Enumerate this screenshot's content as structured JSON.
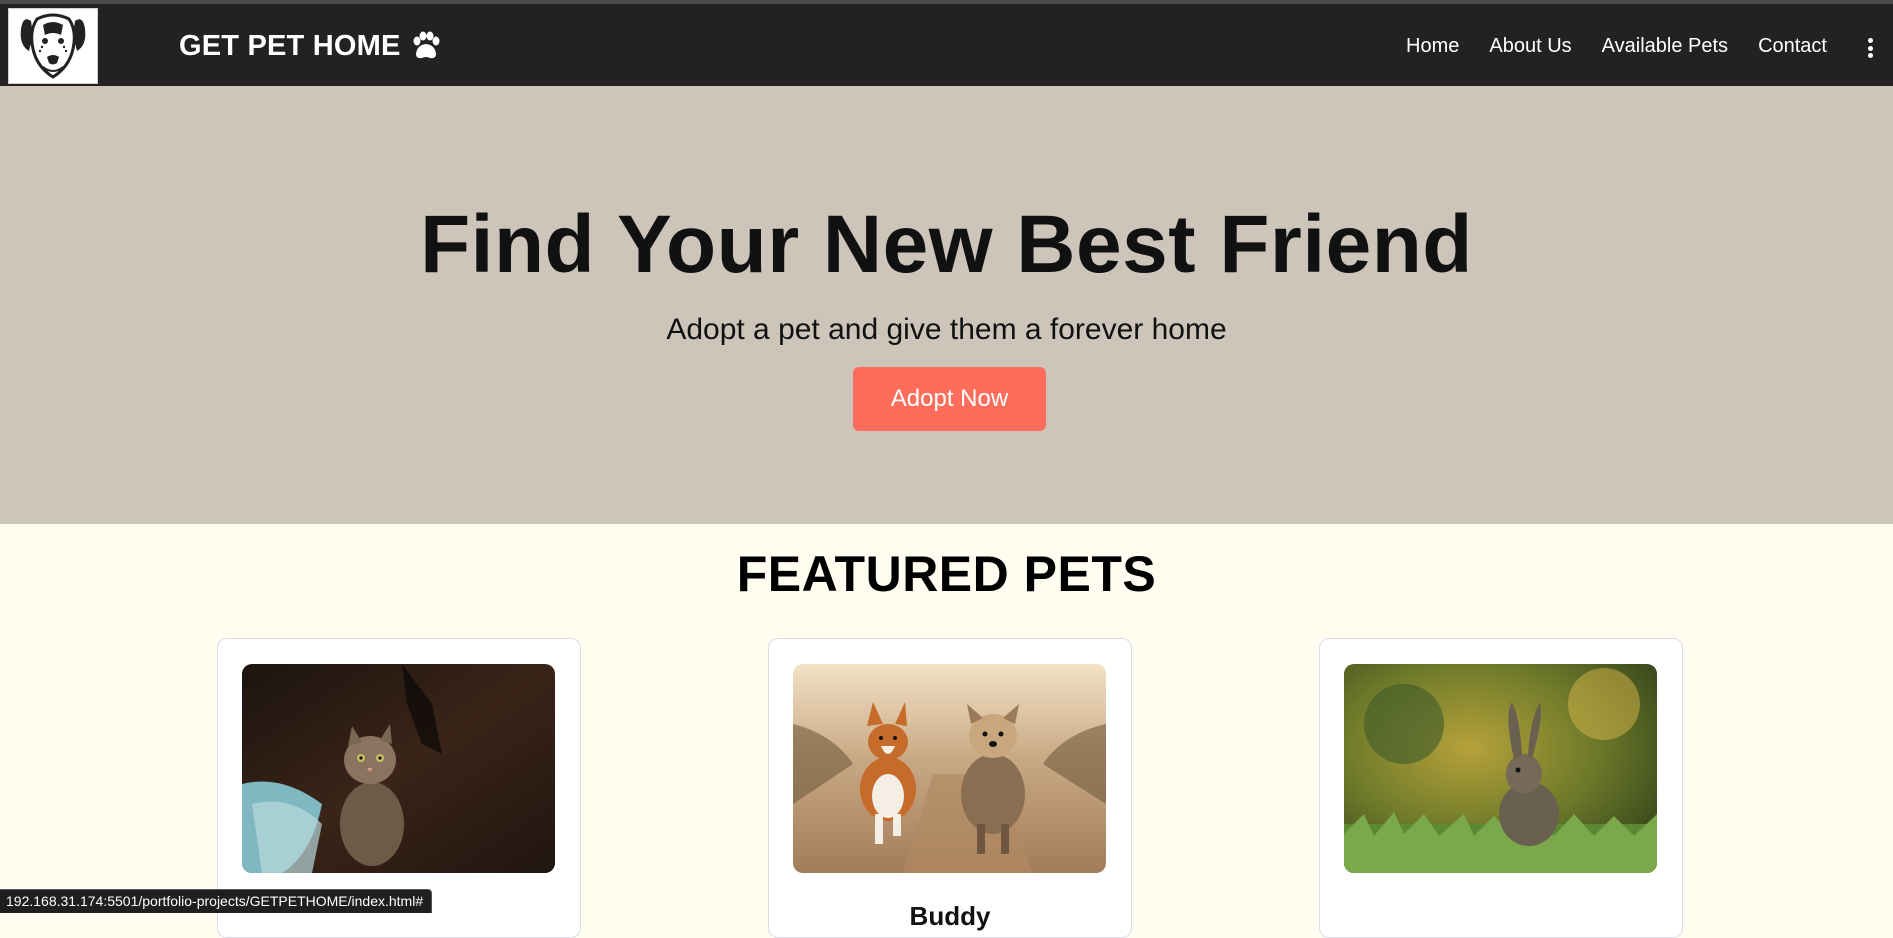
{
  "nav": {
    "brand": "GET PET HOME",
    "links": [
      "Home",
      "About Us",
      "Available Pets",
      "Contact"
    ]
  },
  "hero": {
    "title": "Find Your New Best Friend",
    "subtitle": "Adopt a pet and give them a forever home",
    "cta": "Adopt Now"
  },
  "featured": {
    "title": "FEATURED PETS",
    "cards": [
      {
        "name": "",
        "photo": "cat-photo"
      },
      {
        "name": "Buddy",
        "photo": "dogs-photo"
      },
      {
        "name": "",
        "photo": "rabbit-photo"
      }
    ]
  },
  "status_url": "192.168.31.174:5501/portfolio-projects/GETPETHOME/index.html#",
  "colors": {
    "nav_bg": "#232220",
    "hero_bg": "#cdc5b9",
    "page_bg": "#fffdf0",
    "accent": "#fe6d5c"
  }
}
